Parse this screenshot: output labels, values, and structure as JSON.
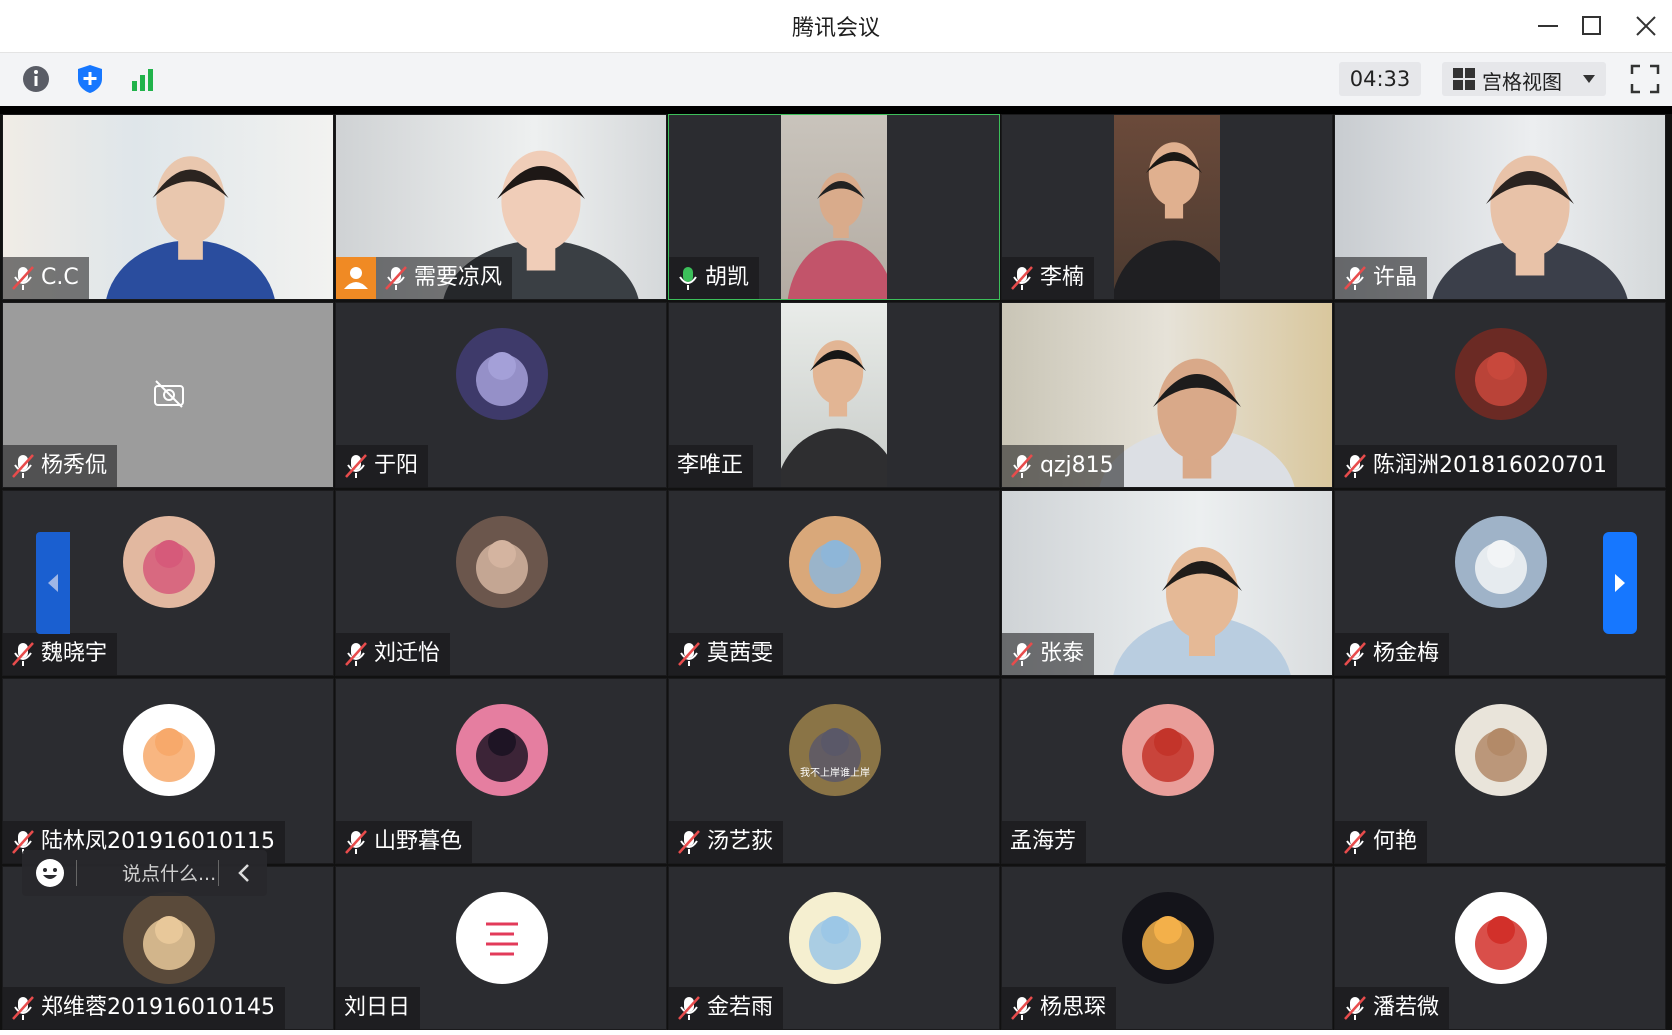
{
  "window": {
    "title": "腾讯会议"
  },
  "toolbar": {
    "icons": [
      "info-icon",
      "shield-icon",
      "signal-bars-icon"
    ],
    "timer": "04:33",
    "view_mode": "宫格视图"
  },
  "colors": {
    "accent_blue": "#1677ff",
    "active_speaker": "#3cbf5a",
    "host_badge": "#f08a24",
    "muted_mic": "#e84c4c"
  },
  "participants": [
    {
      "name": "C.C",
      "muted": true
    },
    {
      "name": "需要凉风",
      "muted": true,
      "host": true
    },
    {
      "name": "胡凯",
      "muted": false,
      "speaking": true
    },
    {
      "name": "李楠",
      "muted": true
    },
    {
      "name": "许晶",
      "muted": true
    },
    {
      "name": "杨秀侃",
      "muted": true,
      "camera_off": true
    },
    {
      "name": "于阳",
      "muted": true
    },
    {
      "name": "李唯正",
      "muted": false
    },
    {
      "name": "qzj815",
      "muted": true
    },
    {
      "name": "陈润洲201816020701",
      "muted": true
    },
    {
      "name": "魏晓宇",
      "muted": true
    },
    {
      "name": "刘迁怡",
      "muted": true
    },
    {
      "name": "莫茜雯",
      "muted": true
    },
    {
      "name": "张泰",
      "muted": true
    },
    {
      "name": "杨金梅",
      "muted": true
    },
    {
      "name": "陆林凤201916010115",
      "muted": true
    },
    {
      "name": "山野暮色",
      "muted": true
    },
    {
      "name": "汤艺荻",
      "muted": true
    },
    {
      "name": "孟海芳",
      "muted": false
    },
    {
      "name": "何艳",
      "muted": true
    },
    {
      "name": "郑维蓉201916010145",
      "muted": true
    },
    {
      "name": "刘日日",
      "muted": false
    },
    {
      "name": "金若雨",
      "muted": true
    },
    {
      "name": "杨思琛",
      "muted": true
    },
    {
      "name": "潘若微",
      "muted": true
    }
  ],
  "avatar_texts": {
    "tom_cat": "我不上岸谁上岸"
  },
  "chat": {
    "placeholder": "说点什么..."
  }
}
